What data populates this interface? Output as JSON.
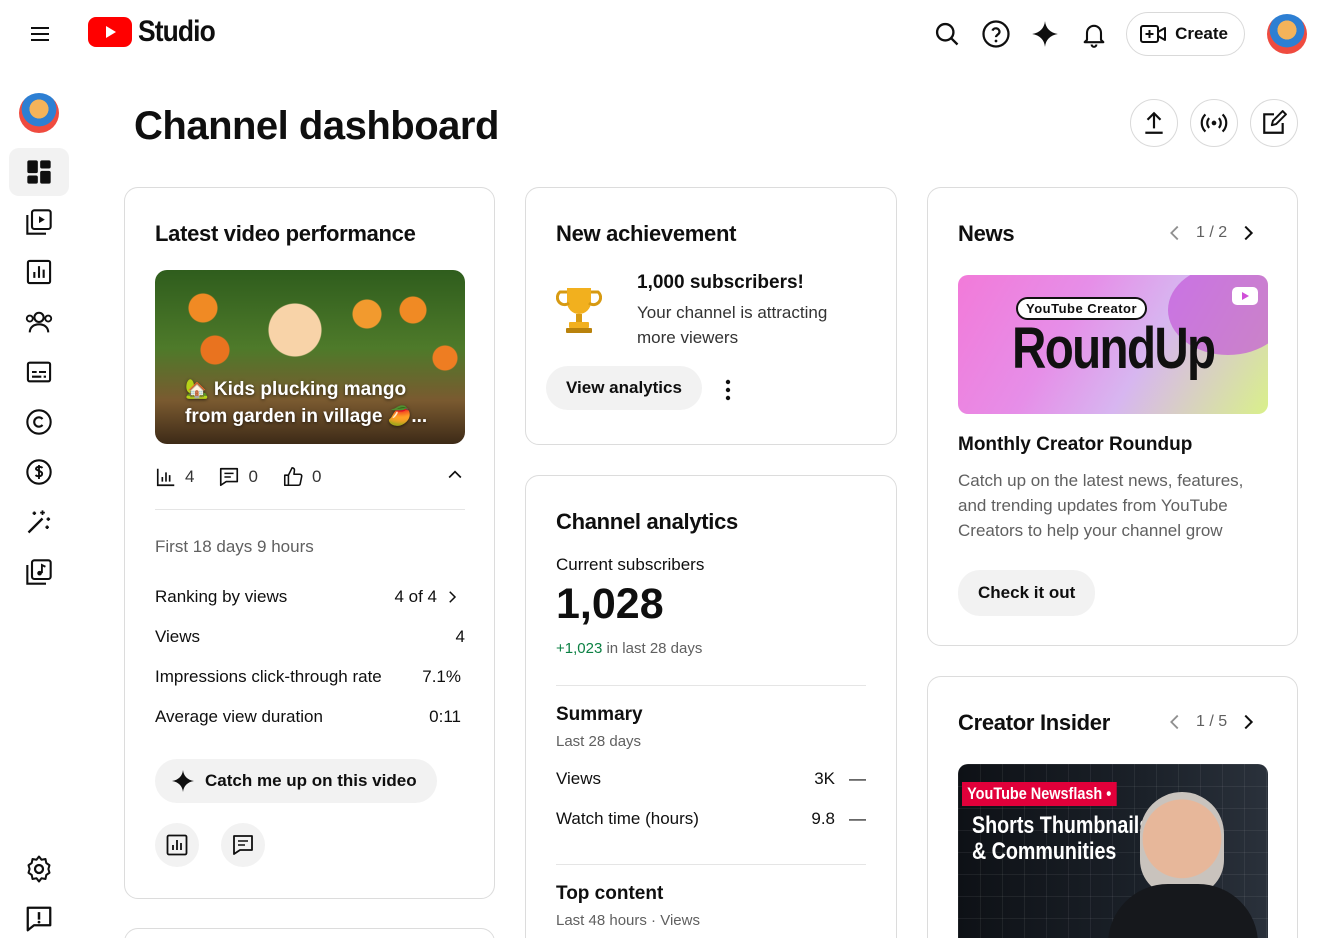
{
  "app": {
    "logo_text": "Studio"
  },
  "topbar": {
    "create_label": "Create"
  },
  "page": {
    "title": "Channel dashboard"
  },
  "latest_video": {
    "card_title": "Latest video performance",
    "video_title": "🏡 Kids plucking mango from garden in village 🥭...",
    "views_count": "4",
    "comments_count": "0",
    "likes_count": "0",
    "period": "First 18 days 9 hours",
    "rows": [
      {
        "label": "Ranking by views",
        "value": "4 of 4"
      },
      {
        "label": "Views",
        "value": "4"
      },
      {
        "label": "Impressions click-through rate",
        "value": "7.1%"
      },
      {
        "label": "Average view duration",
        "value": "0:11"
      }
    ],
    "catch_up_label": "Catch me up on this video"
  },
  "achievement": {
    "card_title": "New achievement",
    "headline": "1,000 subscribers!",
    "description": "Your channel is attracting more viewers",
    "button_label": "View analytics"
  },
  "analytics": {
    "card_title": "Channel analytics",
    "subs_label": "Current subscribers",
    "subs_value": "1,028",
    "subs_change": "+1,023",
    "subs_change_suffix": "in last 28 days",
    "summary_title": "Summary",
    "summary_period": "Last 28 days",
    "summary_rows": [
      {
        "label": "Views",
        "value": "3K",
        "trend": "—"
      },
      {
        "label": "Watch time (hours)",
        "value": "9.8",
        "trend": "—"
      }
    ],
    "top_content_title": "Top content",
    "top_content_period": "Last 48 hours · Views"
  },
  "news": {
    "card_title": "News",
    "pager": "1 / 2",
    "banner_tag": "YouTube Creator",
    "banner_title": "RoundUp",
    "article_title": "Monthly Creator Roundup",
    "article_desc": "Catch up on the latest news, features, and trending updates from YouTube Creators to help your channel grow",
    "button_label": "Check it out"
  },
  "insider": {
    "card_title": "Creator Insider",
    "pager": "1 / 5",
    "banner_tag": "YouTube Newsflash •",
    "banner_line1": "Shorts Thumbnails",
    "banner_line2": "& Communities"
  },
  "colors": {
    "brand_red": "#ff0000",
    "positive_green": "#0b8043"
  }
}
